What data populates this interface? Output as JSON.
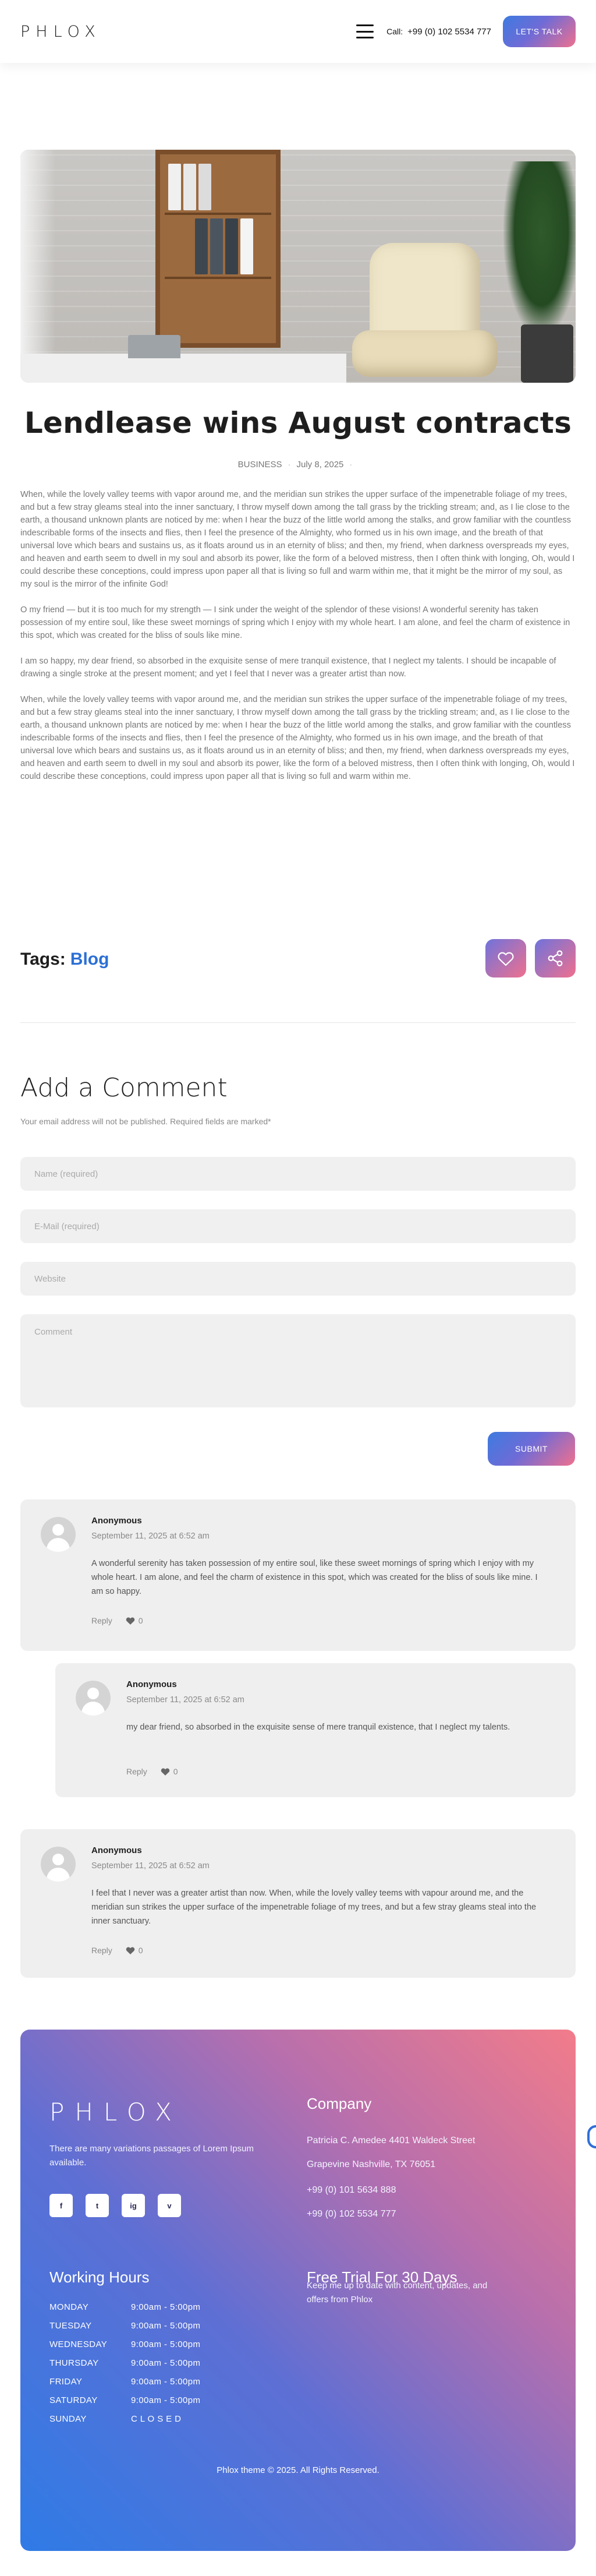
{
  "header": {
    "logo": "PHLOX",
    "call_label": "Call:",
    "call_number": "+99 (0) 102 5534 777",
    "cta_label": "LET'S TALK"
  },
  "post": {
    "title": "Lendlease wins August contracts",
    "category": "BUSINESS",
    "date": "July 8, 2025",
    "paragraphs": [
      "When, while the lovely valley teems with vapor around me, and the meridian sun strikes the upper surface of the impenetrable foliage of my trees, and but a few stray gleams steal into the inner sanctuary, I throw myself down among the tall grass by the trickling stream; and, as I lie close to the earth, a thousand unknown plants are noticed by me: when I hear the buzz of the little world among the stalks, and grow familiar with the countless indescribable forms of the insects and flies, then I feel the presence of the Almighty, who formed us in his own image, and the breath of that universal love which bears and sustains us, as it floats around us in an eternity of bliss; and then, my friend, when darkness overspreads my eyes, and heaven and earth seem to dwell in my soul and absorb its power, like the form of a beloved mistress, then I often think with longing, Oh, would I could describe these conceptions, could impress upon paper all that is living so full and warm within me, that it might be the mirror of my soul, as my soul is the mirror of the infinite God!",
      "O my friend — but it is too much for my strength — I sink under the weight of the splendor of these visions! A wonderful serenity has taken possession of my entire soul, like these sweet mornings of spring which I enjoy with my whole heart. I am alone, and feel the charm of existence in this spot, which was created for the bliss of souls like mine.",
      "I am so happy, my dear friend, so absorbed in the exquisite sense of mere tranquil existence, that I neglect my talents. I should be incapable of drawing a single stroke at the present moment; and yet I feel that I never was a greater artist than now.",
      "When, while the lovely valley teems with vapor around me, and the meridian sun strikes the upper surface of the impenetrable foliage of my trees, and but a few stray gleams steal into the inner sanctuary, I throw myself down among the tall grass by the trickling stream; and, as I lie close to the earth, a thousand unknown plants are noticed by me: when I hear the buzz of the little world among the stalks, and grow familiar with the countless indescribable forms of the insects and flies, then I feel the presence of the Almighty, who formed us in his own image, and the breath of that universal love which bears and sustains us, as it floats around us in an eternity of bliss; and then, my friend, when darkness overspreads my eyes, and heaven and earth seem to dwell in my soul and absorb its power, like the form of a beloved mistress, then I often think with longing, Oh, would I could describe these conceptions, could impress upon paper all that is living so full and warm within me."
    ],
    "tags_label": "Tags:",
    "tag": "Blog"
  },
  "form": {
    "title": "Add a Comment",
    "note": "Your email address will not be published. Required fields are marked*",
    "name_placeholder": "Name (required)",
    "email_placeholder": "E-Mail (required)",
    "website_placeholder": "Website",
    "comment_placeholder": "Comment",
    "submit_label": "SUBMIT"
  },
  "comments": [
    {
      "author": "Anonymous",
      "date": "September 11, 2025 at 6:52 am",
      "text": "A wonderful serenity has taken possession of my entire soul, like these sweet mornings of spring which I enjoy with my whole heart. I am alone, and feel the charm of existence in this spot, which was created for the bliss of souls like mine. I am so happy.",
      "reply_label": "Reply",
      "likes": "0"
    },
    {
      "author": "Anonymous",
      "date": "September 11, 2025 at 6:52 am",
      "text": "my dear friend, so absorbed in the exquisite sense of mere tranquil existence, that I neglect my talents.",
      "reply_label": "Reply",
      "likes": "0"
    },
    {
      "author": "Anonymous",
      "date": "September 11, 2025 at 6:52 am",
      "text": "I feel that I never was a greater artist than now. When, while the lovely valley teems with vapour around me, and the meridian sun strikes the upper surface of the impenetrable foliage of my trees, and but a few stray gleams steal into the inner sanctuary.",
      "reply_label": "Reply",
      "likes": "0"
    }
  ],
  "footer": {
    "logo": "PHLOX",
    "description": "There are many variations passages of Lorem Ipsum available.",
    "socials": [
      "f",
      "t",
      "ig",
      "v"
    ],
    "company_heading": "Company",
    "address_1": "Patricia C. Amedee 4401 Waldeck Street",
    "address_2": "Grapevine Nashville, TX 76051",
    "phone_1": "+99 (0) 101 5634 888",
    "phone_2": "+99 (0) 102 5534 777",
    "hours_heading": "Working Hours",
    "hours": [
      {
        "day": "MONDAY",
        "time": "9:00am - 5:00pm"
      },
      {
        "day": "TUESDAY",
        "time": "9:00am - 5:00pm"
      },
      {
        "day": "WEDNESDAY",
        "time": "9:00am - 5:00pm"
      },
      {
        "day": "THURSDAY",
        "time": "9:00am - 5:00pm"
      },
      {
        "day": "FRIDAY",
        "time": "9:00am - 5:00pm"
      },
      {
        "day": "SATURDAY",
        "time": "9:00am - 5:00pm"
      },
      {
        "day": "SUNDAY",
        "time": "C L O S E D"
      }
    ],
    "trial_heading": "Free Trial For 30 Days",
    "trial_text": "Keep me up to date with content, updates, and offers from Phlox",
    "copyright": "Phlox theme © 2025. All Rights Reserved."
  },
  "colors": {
    "accent_blue": "#2c6fd6",
    "gradient_start": "#3d7be0",
    "gradient_end": "#f0708d"
  }
}
